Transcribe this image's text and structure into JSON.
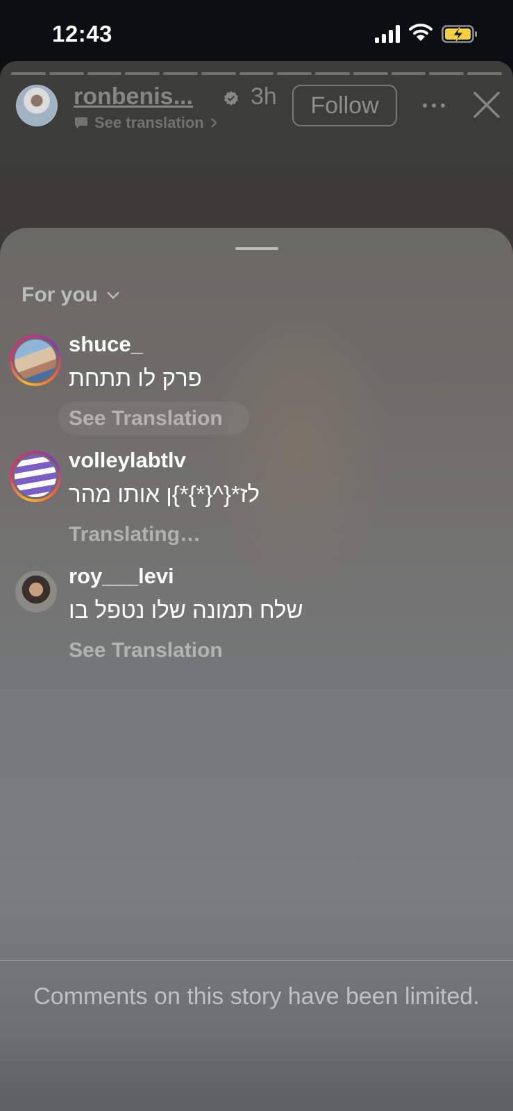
{
  "status_bar": {
    "time": "12:43",
    "icons": [
      "cellular-signal-icon",
      "wifi-icon",
      "battery-charging-icon"
    ],
    "battery_color": "#f4d03f"
  },
  "story": {
    "author": "ronbenis...",
    "verified_icon": "verified-badge-icon",
    "time_ago": "3h",
    "see_translation": "See translation",
    "follow_label": "Follow",
    "more_icon": "more-horizontal-icon",
    "close_icon": "close-icon"
  },
  "sheet": {
    "filter_label": "For you",
    "filter_icon": "chevron-down-icon",
    "comments": [
      {
        "username": "shuce_",
        "text": "פרק לו תתחת",
        "translate_label": "See Translation"
      },
      {
        "username": "volleylabtlv",
        "text": "לז*{^{*}*}ן אותו מהר",
        "translate_label": "Translating…"
      },
      {
        "username": "roy___levi",
        "text": "שלח תמונה שלו נטפל בו",
        "translate_label": "See Translation"
      }
    ],
    "limited_note": "Comments on this story have been limited."
  }
}
